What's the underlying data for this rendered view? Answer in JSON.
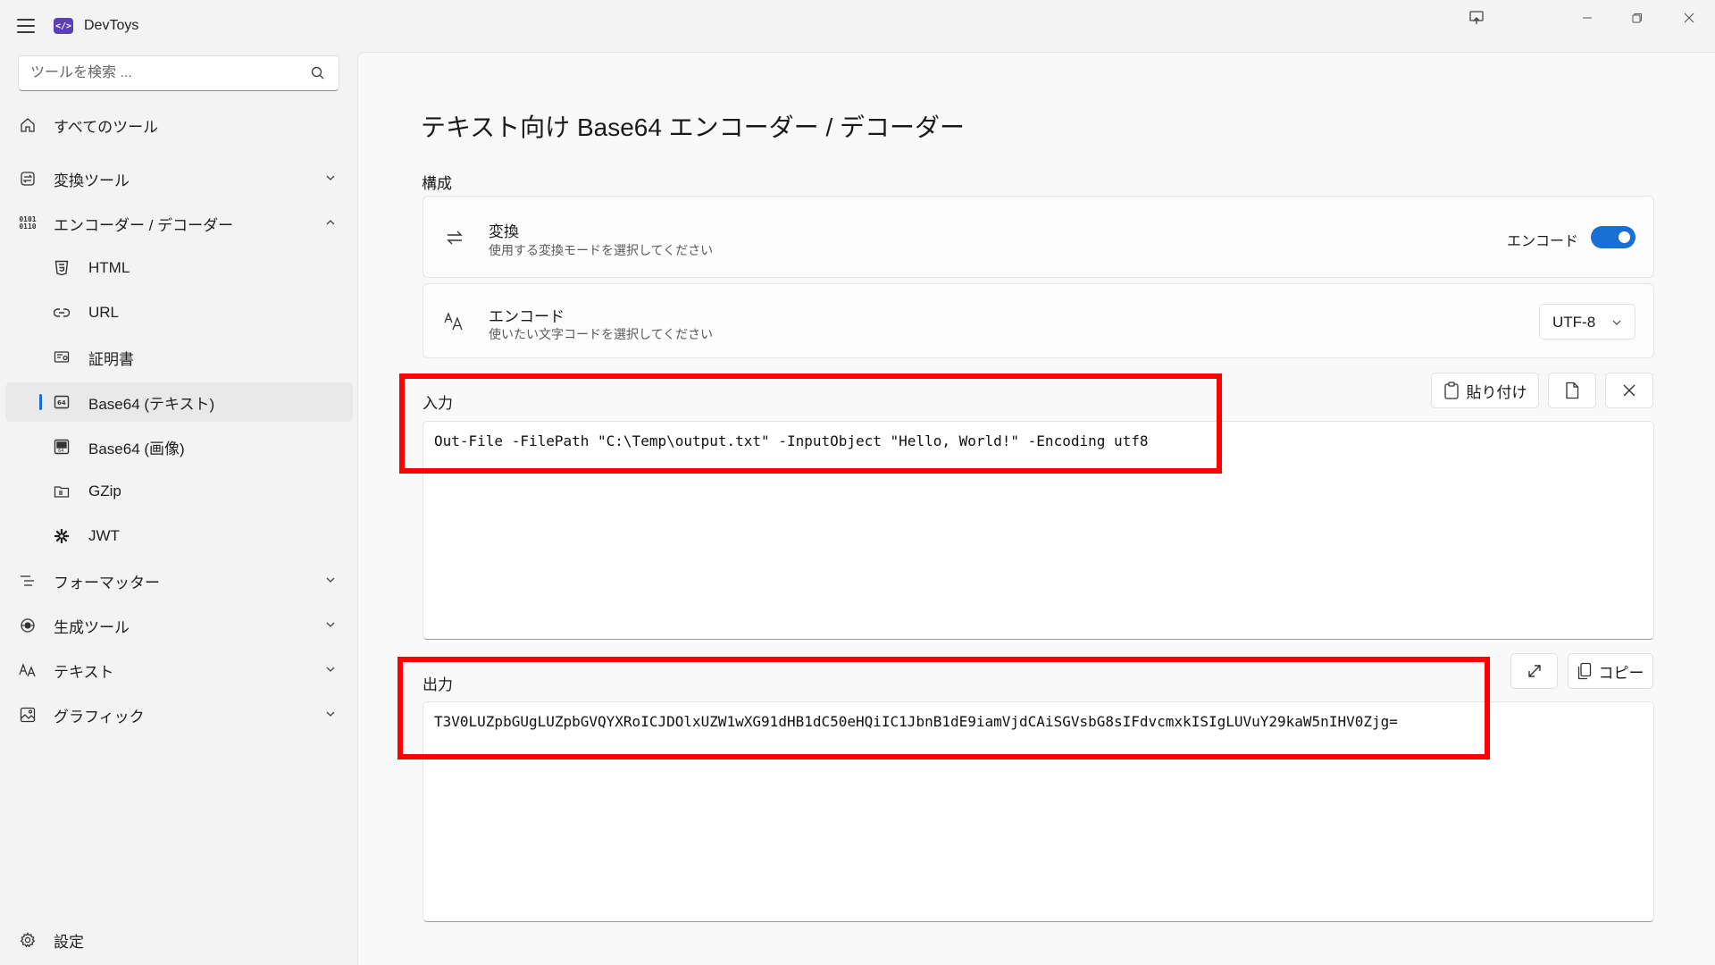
{
  "app": {
    "title": "DevToys",
    "logo_text": "</>"
  },
  "search": {
    "placeholder": "ツールを検索 ..."
  },
  "sidebar": {
    "items": [
      {
        "label": "すべてのツール",
        "icon": "home-icon"
      },
      {
        "label": "変換ツール",
        "icon": "converter-icon",
        "expanded": false
      },
      {
        "label": "エンコーダー / デコーダー",
        "icon": "binary-icon",
        "expanded": true
      },
      {
        "label": "HTML",
        "icon": "html5-icon"
      },
      {
        "label": "URL",
        "icon": "link-icon"
      },
      {
        "label": "証明書",
        "icon": "certificate-icon"
      },
      {
        "label": "Base64 (テキスト)",
        "icon": "base64-text-icon",
        "selected": true
      },
      {
        "label": "Base64 (画像)",
        "icon": "base64-image-icon"
      },
      {
        "label": "GZip",
        "icon": "gzip-icon"
      },
      {
        "label": "JWT",
        "icon": "jwt-icon"
      },
      {
        "label": "フォーマッター",
        "icon": "formatter-icon",
        "expanded": false
      },
      {
        "label": "生成ツール",
        "icon": "generator-icon",
        "expanded": false
      },
      {
        "label": "テキスト",
        "icon": "text-icon",
        "expanded": false
      },
      {
        "label": "グラフィック",
        "icon": "graphic-icon",
        "expanded": false
      }
    ],
    "settings_label": "設定"
  },
  "main": {
    "title": "テキスト向け Base64 エンコーダー / デコーダー",
    "config_label": "構成",
    "conversion": {
      "title": "変換",
      "subtitle": "使用する変換モードを選択してください",
      "toggle_label": "エンコード",
      "toggle_on": true
    },
    "encoding": {
      "title": "エンコード",
      "subtitle": "使いたい文字コードを選択してください",
      "selected": "UTF-8"
    },
    "input": {
      "label": "入力",
      "paste_label": "貼り付け",
      "value": "Out-File -FilePath \"C:\\Temp\\output.txt\" -InputObject \"Hello, World!\" -Encoding utf8"
    },
    "output": {
      "label": "出力",
      "copy_label": "コピー",
      "value": "T3V0LUZpbGUgLUZpbGVQYXRoICJDOlxUZW1wXG91dHB1dC50eHQiIC1JbnB1dE9iamVjdCAiSGVsbG8sIFdvcmxkISIgLUVuY29kaW5nIHV0Zjg="
    },
    "accent_color": "#1a6fd4",
    "highlight_color": "#ff0000"
  }
}
